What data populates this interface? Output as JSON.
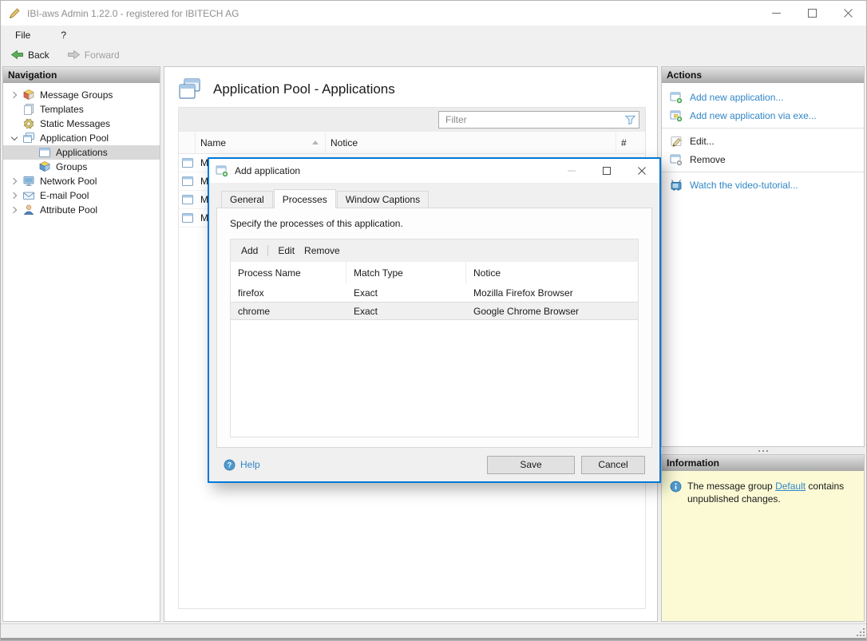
{
  "window": {
    "title": "IBI-aws Admin 1.22.0 - registered for IBITECH AG"
  },
  "menu": {
    "items": [
      "File",
      "?"
    ]
  },
  "toolbar": {
    "back_label": "Back",
    "forward_label": "Forward"
  },
  "nav": {
    "header": "Navigation",
    "items": [
      {
        "label": "Message Groups"
      },
      {
        "label": "Templates"
      },
      {
        "label": "Static Messages"
      },
      {
        "label": "Application Pool"
      },
      {
        "label": "Applications"
      },
      {
        "label": "Groups"
      },
      {
        "label": "Network Pool"
      },
      {
        "label": "E-mail Pool"
      },
      {
        "label": "Attribute Pool"
      }
    ]
  },
  "main": {
    "title": "Application Pool - Applications",
    "filter_placeholder": "Filter",
    "columns": {
      "name": "Name",
      "notice": "Notice",
      "count": "#"
    },
    "rows": [
      {
        "name": "M"
      },
      {
        "name": "M"
      },
      {
        "name": "M"
      },
      {
        "name": "M"
      }
    ]
  },
  "actions": {
    "header": "Actions",
    "items": [
      "Add new application...",
      "Add new application via exe...",
      "Edit...",
      "Remove",
      "Watch the video-tutorial..."
    ]
  },
  "information": {
    "header": "Information",
    "text_before": "The message group ",
    "link": "Default",
    "text_after": " contains unpublished changes."
  },
  "dialog": {
    "title": "Add application",
    "tabs": [
      "General",
      "Processes",
      "Window Captions"
    ],
    "active_tab": "Processes",
    "caption": "Specify the processes of this application.",
    "toolbar": [
      "Add",
      "Edit",
      "Remove"
    ],
    "table": {
      "columns": [
        "Process Name",
        "Match Type",
        "Notice"
      ],
      "rows": [
        {
          "process_name": "firefox",
          "match_type": "Exact",
          "notice": "Mozilla Firefox Browser"
        },
        {
          "process_name": "chrome",
          "match_type": "Exact",
          "notice": "Google Chrome Browser"
        }
      ]
    },
    "help_label": "Help",
    "save_label": "Save",
    "cancel_label": "Cancel"
  },
  "colors": {
    "accent_link": "#3186c6",
    "dialog_border": "#0079d8",
    "info_background": "#fbfad5"
  }
}
